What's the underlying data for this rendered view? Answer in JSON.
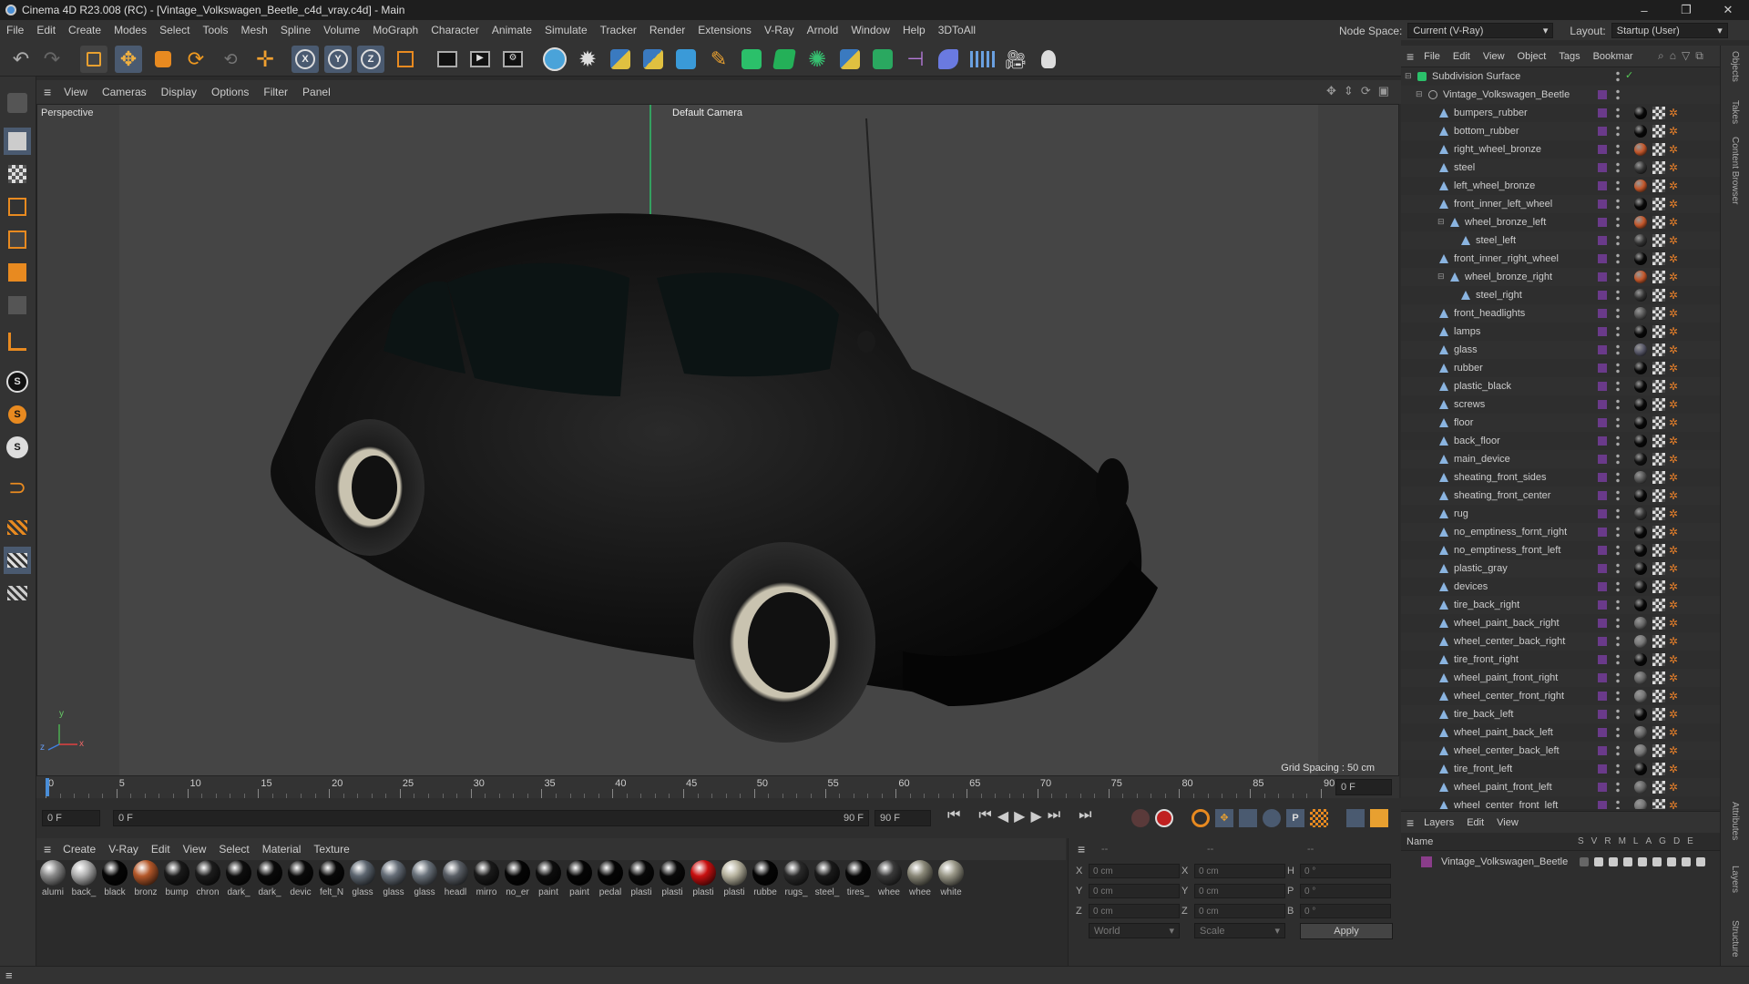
{
  "window": {
    "title": "Cinema 4D R23.008 (RC) - [Vintage_Volkswagen_Beetle_c4d_vray.c4d] - Main",
    "controls": [
      "–",
      "❐",
      "✕"
    ]
  },
  "menubar": [
    "File",
    "Edit",
    "Create",
    "Modes",
    "Select",
    "Tools",
    "Mesh",
    "Spline",
    "Volume",
    "MoGraph",
    "Character",
    "Animate",
    "Simulate",
    "Tracker",
    "Render",
    "Extensions",
    "V-Ray",
    "Arnold",
    "Window",
    "Help",
    "3DToAll"
  ],
  "node_space": {
    "label": "Node Space:",
    "value": "Current (V-Ray)"
  },
  "layout": {
    "label": "Layout:",
    "value": "Startup (User)"
  },
  "viewport": {
    "menu": [
      "View",
      "Cameras",
      "Display",
      "Options",
      "Filter",
      "Panel"
    ],
    "label": "Perspective",
    "camera": "Default Camera",
    "grid_spacing": "Grid Spacing : 50 cm",
    "axis": {
      "y": "y",
      "z": "z",
      "x": "x"
    }
  },
  "timeline": {
    "ticks": [
      "0",
      "5",
      "10",
      "15",
      "20",
      "25",
      "30",
      "35",
      "40",
      "45",
      "50",
      "55",
      "60",
      "65",
      "70",
      "75",
      "80",
      "85",
      "90"
    ],
    "current_frame": "0 F",
    "start_field": "0 F",
    "range_start": "0 F",
    "range_end": "90 F",
    "end_field": "90 F"
  },
  "material_manager": {
    "menu": [
      "Create",
      "V-Ray",
      "Edit",
      "View",
      "Select",
      "Material",
      "Texture"
    ],
    "materials": [
      {
        "name": "alumi",
        "color": "#8a8a8a"
      },
      {
        "name": "back_",
        "color": "#b0b0b0"
      },
      {
        "name": "black",
        "color": "#050505"
      },
      {
        "name": "bronz",
        "color": "#b4582a"
      },
      {
        "name": "bump",
        "color": "#1a1a1a"
      },
      {
        "name": "chron",
        "color": "#1c1c1c"
      },
      {
        "name": "dark_",
        "color": "#0e0e0e"
      },
      {
        "name": "dark_",
        "color": "#0a0a0a"
      },
      {
        "name": "devic",
        "color": "#0a0a0a"
      },
      {
        "name": "felt_N",
        "color": "#080808"
      },
      {
        "name": "glass",
        "color": "#5d6670"
      },
      {
        "name": "glass",
        "color": "#666e78"
      },
      {
        "name": "glass",
        "color": "#6b737c"
      },
      {
        "name": "headl",
        "color": "#5a5f66"
      },
      {
        "name": "mirro",
        "color": "#1a1a1a"
      },
      {
        "name": "no_er",
        "color": "#050505"
      },
      {
        "name": "paint",
        "color": "#0d0d0d"
      },
      {
        "name": "paint",
        "color": "#050505"
      },
      {
        "name": "pedal",
        "color": "#050505"
      },
      {
        "name": "plasti",
        "color": "#080808"
      },
      {
        "name": "plasti",
        "color": "#0a0a0a"
      },
      {
        "name": "plasti",
        "color": "#c81010"
      },
      {
        "name": "plasti",
        "color": "#b8b4a0"
      },
      {
        "name": "rubbe",
        "color": "#050505"
      },
      {
        "name": "rugs_",
        "color": "#2a2a2a"
      },
      {
        "name": "steel_",
        "color": "#1a1a1a"
      },
      {
        "name": "tires_",
        "color": "#070707"
      },
      {
        "name": "whee",
        "color": "#3a3a3a"
      },
      {
        "name": "whee",
        "color": "#8a8878"
      },
      {
        "name": "white",
        "color": "#9a9888"
      }
    ]
  },
  "coordinates": {
    "header": "--",
    "rows": [
      {
        "a": "X",
        "av": "0 cm",
        "b": "X",
        "bv": "0 cm",
        "c": "H",
        "cv": "0 °"
      },
      {
        "a": "Y",
        "av": "0 cm",
        "b": "Y",
        "bv": "0 cm",
        "c": "P",
        "cv": "0 °"
      },
      {
        "a": "Z",
        "av": "0 cm",
        "b": "Z",
        "bv": "0 cm",
        "c": "B",
        "cv": "0 °"
      }
    ],
    "mode": "World",
    "scale": "Scale",
    "apply": "Apply"
  },
  "object_manager": {
    "menu": [
      "File",
      "Edit",
      "View",
      "Object",
      "Tags",
      "Bookmar"
    ],
    "objects": [
      {
        "name": "Subdivision Surface",
        "level": 0,
        "tag": "none"
      },
      {
        "name": "Vintage_Volkswagen_Beetle",
        "level": 1,
        "tag": "none"
      },
      {
        "name": "bumpers_rubber",
        "level": 2,
        "tag": "#080808"
      },
      {
        "name": "bottom_rubber",
        "level": 2,
        "tag": "#080808"
      },
      {
        "name": "right_wheel_bronze",
        "level": 2,
        "tag": "#c4572a"
      },
      {
        "name": "steel",
        "level": 2,
        "tag": "#333"
      },
      {
        "name": "left_wheel_bronze",
        "level": 2,
        "tag": "#c4572a"
      },
      {
        "name": "front_inner_left_wheel",
        "level": 2,
        "tag": "#080808"
      },
      {
        "name": "wheel_bronze_left",
        "level": 3,
        "tag": "#c4572a"
      },
      {
        "name": "steel_left",
        "level": 4,
        "tag": "#333"
      },
      {
        "name": "front_inner_right_wheel",
        "level": 2,
        "tag": "#080808"
      },
      {
        "name": "wheel_bronze_right",
        "level": 3,
        "tag": "#c4572a"
      },
      {
        "name": "steel_right",
        "level": 4,
        "tag": "#333"
      },
      {
        "name": "front_headlights",
        "level": 2,
        "tag": "#555"
      },
      {
        "name": "lamps",
        "level": 2,
        "tag": "#080808"
      },
      {
        "name": "glass",
        "level": 2,
        "tag": "#556"
      },
      {
        "name": "rubber",
        "level": 2,
        "tag": "#080808"
      },
      {
        "name": "plastic_black",
        "level": 2,
        "tag": "#080808"
      },
      {
        "name": "screws",
        "level": 2,
        "tag": "#080808"
      },
      {
        "name": "floor",
        "level": 2,
        "tag": "#080808"
      },
      {
        "name": "back_floor",
        "level": 2,
        "tag": "#080808"
      },
      {
        "name": "main_device",
        "level": 2,
        "tag": "#111"
      },
      {
        "name": "sheating_front_sides",
        "level": 2,
        "tag": "#555"
      },
      {
        "name": "sheating_front_center",
        "level": 2,
        "tag": "#080808"
      },
      {
        "name": "rug",
        "level": 2,
        "tag": "#333"
      },
      {
        "name": "no_emptiness_fornt_right",
        "level": 2,
        "tag": "#080808"
      },
      {
        "name": "no_emptiness_front_left",
        "level": 2,
        "tag": "#080808"
      },
      {
        "name": "plastic_gray",
        "level": 2,
        "tag": "#080808"
      },
      {
        "name": "devices",
        "level": 2,
        "tag": "#111"
      },
      {
        "name": "tire_back_right",
        "level": 2,
        "tag": "#080808"
      },
      {
        "name": "wheel_paint_back_right",
        "level": 2,
        "tag": "#666"
      },
      {
        "name": "wheel_center_back_right",
        "level": 2,
        "tag": "#777"
      },
      {
        "name": "tire_front_right",
        "level": 2,
        "tag": "#080808"
      },
      {
        "name": "wheel_paint_front_right",
        "level": 2,
        "tag": "#666"
      },
      {
        "name": "wheel_center_front_right",
        "level": 2,
        "tag": "#777"
      },
      {
        "name": "tire_back_left",
        "level": 2,
        "tag": "#080808"
      },
      {
        "name": "wheel_paint_back_left",
        "level": 2,
        "tag": "#666"
      },
      {
        "name": "wheel_center_back_left",
        "level": 2,
        "tag": "#777"
      },
      {
        "name": "tire_front_left",
        "level": 2,
        "tag": "#080808"
      },
      {
        "name": "wheel_paint_front_left",
        "level": 2,
        "tag": "#666"
      },
      {
        "name": "wheel_center_front_left",
        "level": 2,
        "tag": "#777"
      }
    ]
  },
  "side_tabs": [
    "Objects",
    "Takes",
    "Content Browser",
    "Attributes",
    "Layers",
    "Structure"
  ],
  "layers": {
    "menu": [
      "Layers",
      "Edit",
      "View"
    ],
    "columns": {
      "name": "Name",
      "flags": [
        "S",
        "V",
        "R",
        "M",
        "L",
        "A",
        "G",
        "D",
        "E"
      ]
    },
    "items": [
      {
        "name": "Vintage_Volkswagen_Beetle",
        "color": "#8a3d8a"
      }
    ]
  }
}
